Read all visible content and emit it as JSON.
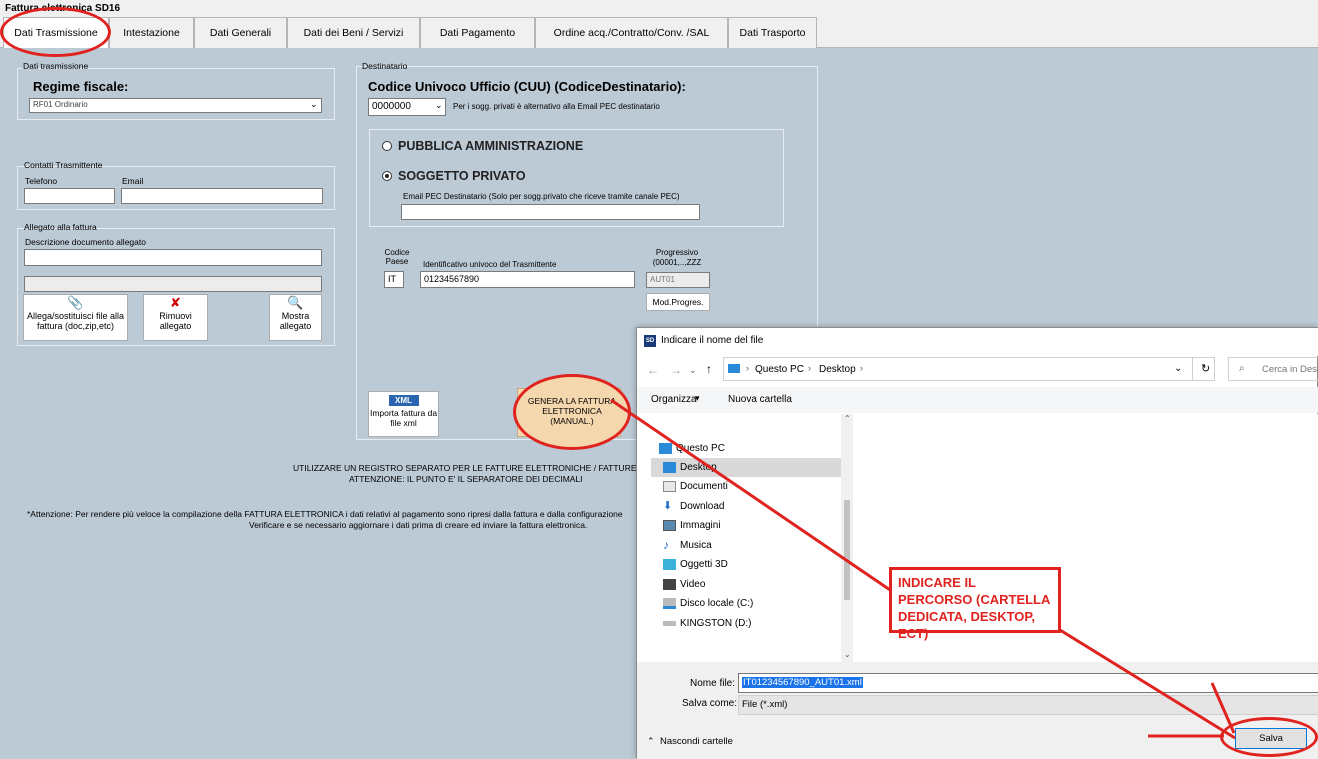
{
  "window": {
    "title": "Fattura elettronica SD16"
  },
  "tabs": [
    "Dati Trasmissione",
    "Intestazione",
    "Dati Generali",
    "Dati dei Beni / Servizi",
    "Dati Pagamento",
    "Ordine acq./Contratto/Conv. /SAL",
    "Dati Trasporto"
  ],
  "dati_trasmissione": {
    "group_label": "Dati trasmissione",
    "regime_label": "Regime fiscale:",
    "regime_value": "RF01 Ordinario"
  },
  "contatti": {
    "group_label": "Contatti Trasmittente",
    "telefono_label": "Telefono",
    "email_label": "Email"
  },
  "allegato": {
    "group_label": "Allegato alla fattura",
    "descrizione_label": "Descrizione documento allegato",
    "allega_btn": "Allega/sostituisci file alla fattura (doc,zip,etc)",
    "rimuovi_btn": "Rimuovi allegato",
    "mostra_btn": "Mostra allegato"
  },
  "destinatario": {
    "group_label": "Destinatario",
    "cuu_label": "Codice Univoco Ufficio (CUU) (CodiceDestinatario):",
    "cuu_value": "0000000",
    "cuu_note": "Per i sogg. privati è alternativo alla Email PEC destinatario",
    "radio_pa": "PUBBLICA AMMINISTRAZIONE",
    "radio_privato": "SOGGETTO PRIVATO",
    "pec_label": "Email PEC Destinatario (Solo per sogg.privato che riceve tramite canale PEC)",
    "codice_paese_label": "Codice Paese",
    "codice_paese_value": "IT",
    "id_trasmittente_label": "Identificativo univoco del Trasmittente",
    "id_trasmittente_value": "01234567890",
    "progressivo_label": "Progressivo (00001,..,ZZZ",
    "progressivo_value": "AUT01",
    "mod_progres_btn": "Mod.Progres."
  },
  "import_btn": {
    "badge": "XML",
    "label": "Importa fattura da file xml"
  },
  "genera_btn": "GENERA LA FATTURA ELETTRONICA (MANUAL.)",
  "notes": {
    "line1": "UTILIZZARE UN REGISTRO SEPARATO PER LE FATTURE ELETTRONICHE / FATTUREPA.",
    "line2": "ATTENZIONE: IL PUNTO  E' IL SEPARATORE DEI DECIMALI",
    "line3": "*Attenzione: Per rendere più veloce la compilazione della FATTURA ELETTRONICA i dati relativi al pagamento sono ripresi dalla fattura e dalla configurazione",
    "line4": "Verificare e se necessario aggiornare i dati prima di creare ed inviare la fattura elettronica."
  },
  "annotation": "INDICARE IL PERCORSO (CARTELLA DEDICATA, DESKTOP, ECT)",
  "dialog": {
    "title": "Indicare il nome del file",
    "icon_text": "SD",
    "breadcrumb": [
      "Questo PC",
      "Desktop"
    ],
    "search_placeholder": "Cerca in Desktop",
    "organizza": "Organizza",
    "nuova_cartella": "Nuova cartella",
    "tree": [
      "Questo PC",
      "Desktop",
      "Documenti",
      "Download",
      "Immagini",
      "Musica",
      "Oggetti 3D",
      "Video",
      "Disco locale (C:)",
      "KINGSTON (D:)"
    ],
    "nome_file_label": "Nome file:",
    "nome_file_value": "IT01234567890_AUT01.xml",
    "salva_come_label": "Salva come:",
    "salva_come_value": "File (*.xml)",
    "nascondi": "Nascondi cartelle",
    "salva_btn": "Salva"
  }
}
